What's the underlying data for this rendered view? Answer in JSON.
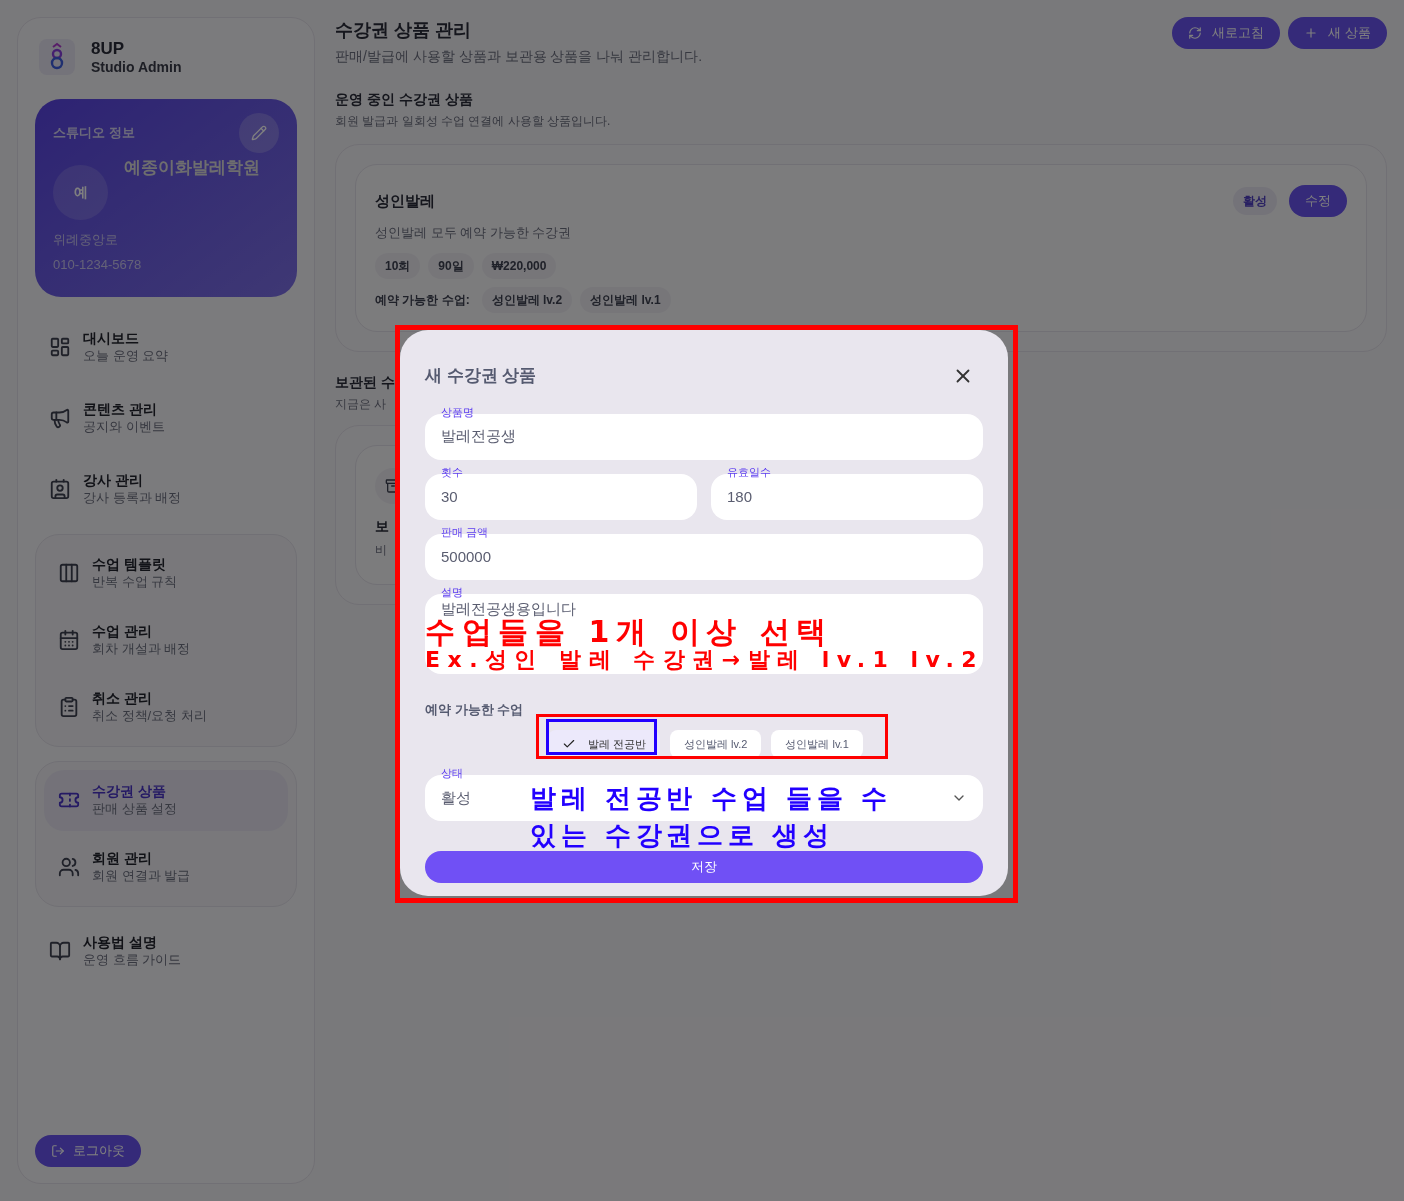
{
  "sidebar": {
    "brand": {
      "name": "8UP",
      "subtitle": "Studio Admin"
    },
    "studio_card": {
      "heading": "스튜디오 정보",
      "avatar": "예",
      "name": "예종이화발레학원",
      "address": "위례중앙로",
      "phone": "010-1234-5678"
    },
    "nav_groups": [
      {
        "boxed": false,
        "items": [
          {
            "title": "대시보드",
            "subtitle": "오늘 운영 요약",
            "selected": false
          },
          {
            "title": "콘텐츠 관리",
            "subtitle": "공지와 이벤트",
            "selected": false
          },
          {
            "title": "강사 관리",
            "subtitle": "강사 등록과 배정",
            "selected": false
          }
        ]
      },
      {
        "boxed": true,
        "items": [
          {
            "title": "수업 템플릿",
            "subtitle": "반복 수업 규칙",
            "selected": false
          },
          {
            "title": "수업 관리",
            "subtitle": "회차 개설과 배정",
            "selected": false
          },
          {
            "title": "취소 관리",
            "subtitle": "취소 정책/요청 처리",
            "selected": false
          }
        ]
      },
      {
        "boxed": true,
        "items": [
          {
            "title": "수강권 상품",
            "subtitle": "판매 상품 설정",
            "selected": true
          },
          {
            "title": "회원 관리",
            "subtitle": "회원 연결과 발급",
            "selected": false
          }
        ]
      },
      {
        "boxed": false,
        "items": [
          {
            "title": "사용법 설명",
            "subtitle": "운영 흐름 가이드",
            "selected": false
          }
        ]
      }
    ],
    "logout": "로그아웃"
  },
  "header": {
    "title": "수강권 상품 관리",
    "subtitle": "판매/발급에 사용할 상품과 보관용 상품을 나눠 관리합니다.",
    "buttons": [
      "새로고침",
      "새 상품"
    ]
  },
  "active_section": {
    "title": "운영 중인 수강권 상품",
    "subtitle": "회원 발급과 일회성 수업 연결에 사용할 상품입니다.",
    "products": [
      {
        "name": "성인발레",
        "status": "활성",
        "edit": "수정",
        "description": "성인발레 모두 예약 가능한 수강권",
        "tags": [
          "10회",
          "90일",
          "₩220,000"
        ],
        "classes_label": "예약 가능한 수업:",
        "classes": [
          "성인발레 lv.2",
          "성인발레 lv.1"
        ]
      }
    ]
  },
  "archived_section": {
    "title": "보관된 수",
    "subtitle": "지금은 사",
    "card_title": "보",
    "card_text": "비"
  },
  "dialog": {
    "title": "새 수강권 상품",
    "fields": [
      {
        "label": "상품명",
        "value": "발레전공생"
      },
      {
        "label": "횟수",
        "value": "30"
      },
      {
        "label": "유효일수",
        "value": "180"
      },
      {
        "label": "판매 금액",
        "value": "500000"
      },
      {
        "label": "설명",
        "value": "발레전공생용입니다"
      }
    ],
    "classes_label": "예약 가능한 수업",
    "classes": [
      {
        "label": "발레 전공반",
        "selected": true
      },
      {
        "label": "성인발레 lv.2",
        "selected": false
      },
      {
        "label": "성인발레 lv.1",
        "selected": false
      }
    ],
    "status": {
      "label": "상태",
      "value": "활성"
    },
    "save": "저장"
  },
  "annotations": [
    {
      "kind": "outline",
      "color": "#ff0000"
    },
    {
      "kind": "outline",
      "color": "#ff0000"
    },
    {
      "kind": "outline",
      "color": "#2200ff"
    },
    {
      "kind": "note",
      "color": "#ff0000",
      "text": "수업들을 1개 이상 선택"
    },
    {
      "kind": "note",
      "color": "#ff0000",
      "text": "Ex.성인 발레 수강권→발레 lv.1 lv.2"
    },
    {
      "kind": "note",
      "color": "#2200ff",
      "text": "발레 전공반 수업 들을 수"
    },
    {
      "kind": "note",
      "color": "#2200ff",
      "text": "있는 수강권으로 생성"
    }
  ]
}
